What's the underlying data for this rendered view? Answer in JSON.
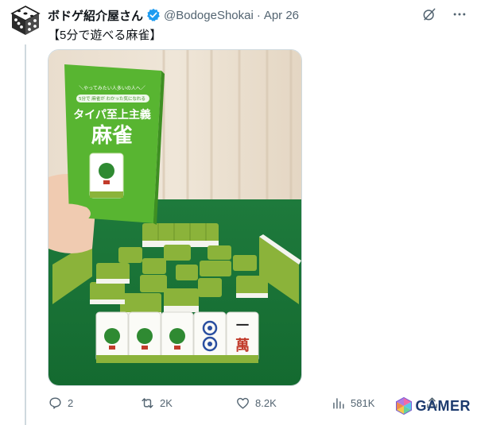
{
  "tweet": {
    "display_name": "ボドゲ紹介屋さん",
    "handle": "@BodogeShokai",
    "separator": "·",
    "date": "Apr 26",
    "text": "【5分で遊べる麻雀】"
  },
  "media": {
    "box_small_top": "＼やってみたい人多いの人へ／",
    "box_small_sub": "5分で 麻雀が わかった気になれる",
    "box_title_1": "タイパ至上主義",
    "box_title_2": "麻雀",
    "tile_character": "一\n萬"
  },
  "actions": {
    "replies": "2",
    "retweets": "2K",
    "likes": "8.2K",
    "views": "581K"
  },
  "watermark": {
    "text": "GAMER"
  },
  "colors": {
    "verified": "#1d9bf0",
    "secondary_text": "#536471",
    "felt": "#1f7a3a",
    "tile_back": "#8bb33a",
    "box_green": "#58b531"
  }
}
